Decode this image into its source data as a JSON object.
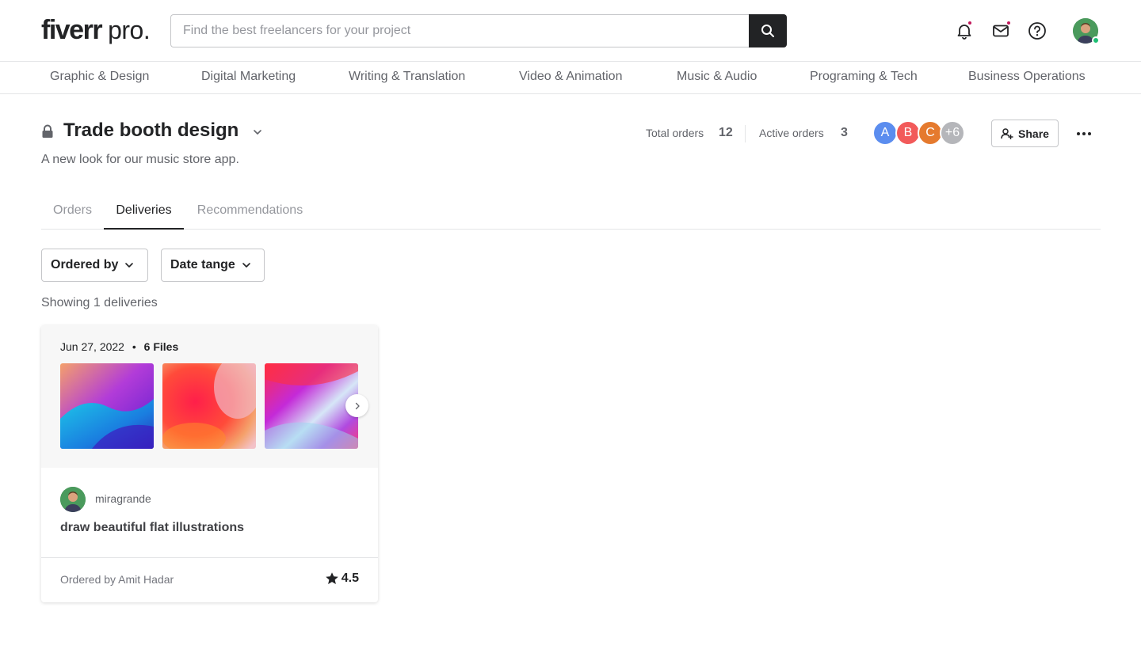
{
  "header": {
    "logo_main": "fiverr",
    "logo_dot": ".",
    "logo_pro": "pro.",
    "search_placeholder": "Find the best freelancers for your project",
    "search_value": ""
  },
  "categories": [
    "Graphic & Design",
    "Digital Marketing",
    "Writing & Translation",
    "Video & Animation",
    "Music & Audio",
    "Programing & Tech",
    "Business Operations"
  ],
  "project": {
    "title": "Trade booth design",
    "description": "A new look for our music store app.",
    "total_orders_label": "Total orders",
    "total_orders_value": "12",
    "active_orders_label": "Active orders",
    "active_orders_value": "3",
    "members": [
      {
        "initial": "A",
        "color": "#5b8def"
      },
      {
        "initial": "B",
        "color": "#f25a5a"
      },
      {
        "initial": "C",
        "color": "#e57a2e"
      },
      {
        "initial": "+6",
        "color": "#b5b6ba"
      }
    ],
    "share_label": "Share"
  },
  "tabs": [
    {
      "label": "Orders",
      "active": false
    },
    {
      "label": "Deliveries",
      "active": true
    },
    {
      "label": "Recommendations",
      "active": false
    }
  ],
  "filters": {
    "ordered_by": "Ordered by",
    "date_range": "Date tange"
  },
  "showing_text": "Showing 1 deliveries",
  "delivery": {
    "date": "Jun 27, 2022",
    "bullet": "•",
    "files": "6 Files",
    "seller": "miragrande",
    "gig_title": "draw beautiful flat illustrations",
    "ordered_by": "Ordered by Amit Hadar",
    "rating": "4.5"
  },
  "colors": {
    "text_dark": "#222325",
    "text_muted": "#62646a",
    "border": "#e4e5e7",
    "online": "#1dbf73",
    "notify_dot": "#c2185b"
  }
}
